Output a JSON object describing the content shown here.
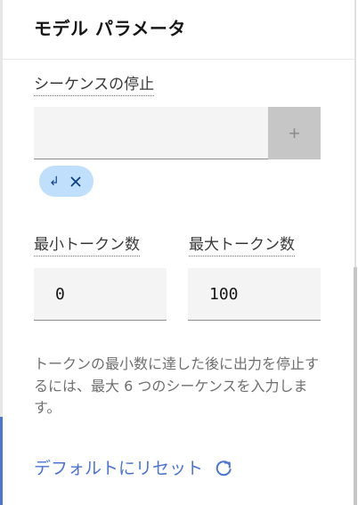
{
  "panel": {
    "title": "モデル パラメータ"
  },
  "stop_sequences": {
    "label": "シーケンスの停止",
    "input_value": "",
    "add_button_label": "+",
    "tags": [
      {
        "label": "↲"
      }
    ]
  },
  "tokens": {
    "min_label": "最小トークン数",
    "min_value": "0",
    "max_label": "最大トークン数",
    "max_value": "100"
  },
  "helper_text": "トークンの最小数に達した後に出力を停止するには、最大 6 つのシーケンスを入力します。",
  "reset_label": "デフォルトにリセット",
  "icons": {
    "tag_close": "close-icon",
    "reset": "refresh-icon"
  },
  "colors": {
    "accent": "#4a74d8",
    "tag_background": "#bfdffd",
    "input_background": "#f4f4f4",
    "disabled_button": "#c6c6c6"
  }
}
